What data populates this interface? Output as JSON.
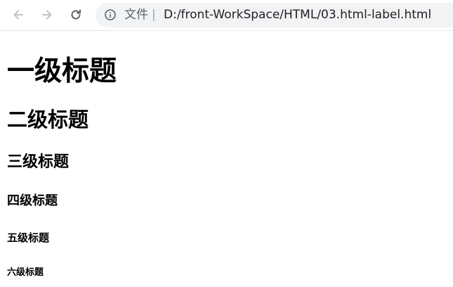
{
  "browser": {
    "icons": {
      "back": "arrow-left-icon",
      "forward": "arrow-right-icon",
      "reload": "reload-icon",
      "info": "info-icon"
    },
    "scheme_label": "文件",
    "separator": "|",
    "url": "D:/front-WorkSpace/HTML/03.html-label.html"
  },
  "content": {
    "h1": "一级标题",
    "h2": "二级标题",
    "h3": "三级标题",
    "h4": "四级标题",
    "h5": "五级标题",
    "h6": "六级标题"
  },
  "colors": {
    "toolbar_bg": "#ffffff",
    "omnibox_bg": "#f1f3f4",
    "icon_disabled": "#bdc1c6",
    "icon_active": "#5f6368",
    "text": "#000000"
  }
}
